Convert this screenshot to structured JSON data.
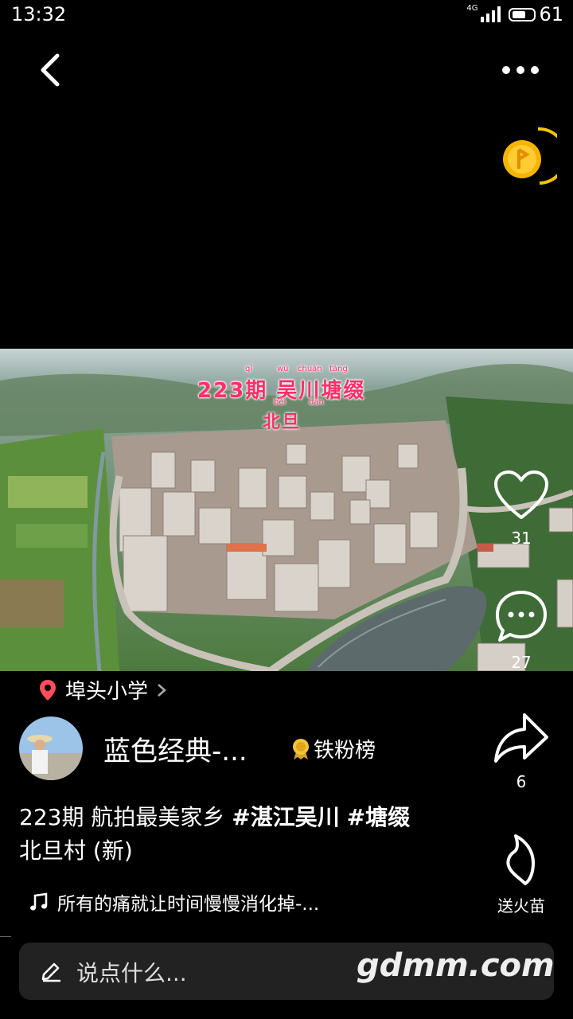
{
  "status": {
    "time": "13:32",
    "network": "4G",
    "battery": "61"
  },
  "video": {
    "overlay_title": "223期 吴川塘 ",
    "overlay_title_main": "223期 吴川塘缀",
    "overlay_subtitle": "北旦",
    "pinyin": [
      "qí",
      "wú",
      "chuān",
      "táng",
      "běi",
      "dàn"
    ]
  },
  "actions": {
    "likes": "31",
    "comments": "27",
    "shares": "6",
    "gift_label": "送火苗"
  },
  "location": {
    "name": "埠头小学"
  },
  "author": {
    "name": "蓝色经典-...",
    "fan_badge": "铁粉榜"
  },
  "description": {
    "text": "223期 航拍最美家乡 ",
    "tag1": "#湛江吴川",
    "tag2": "#塘缀",
    "line2": "北旦村 (新)"
  },
  "music": {
    "title": "所有的痛就让时间慢慢消化掉-..."
  },
  "comment_input": {
    "placeholder": "说点什么..."
  },
  "watermark": "gdmm.com",
  "colors": {
    "accent_red": "#ff2f6a",
    "coin_gold": "#f4b400",
    "location_pin": "#ff4d5a"
  }
}
